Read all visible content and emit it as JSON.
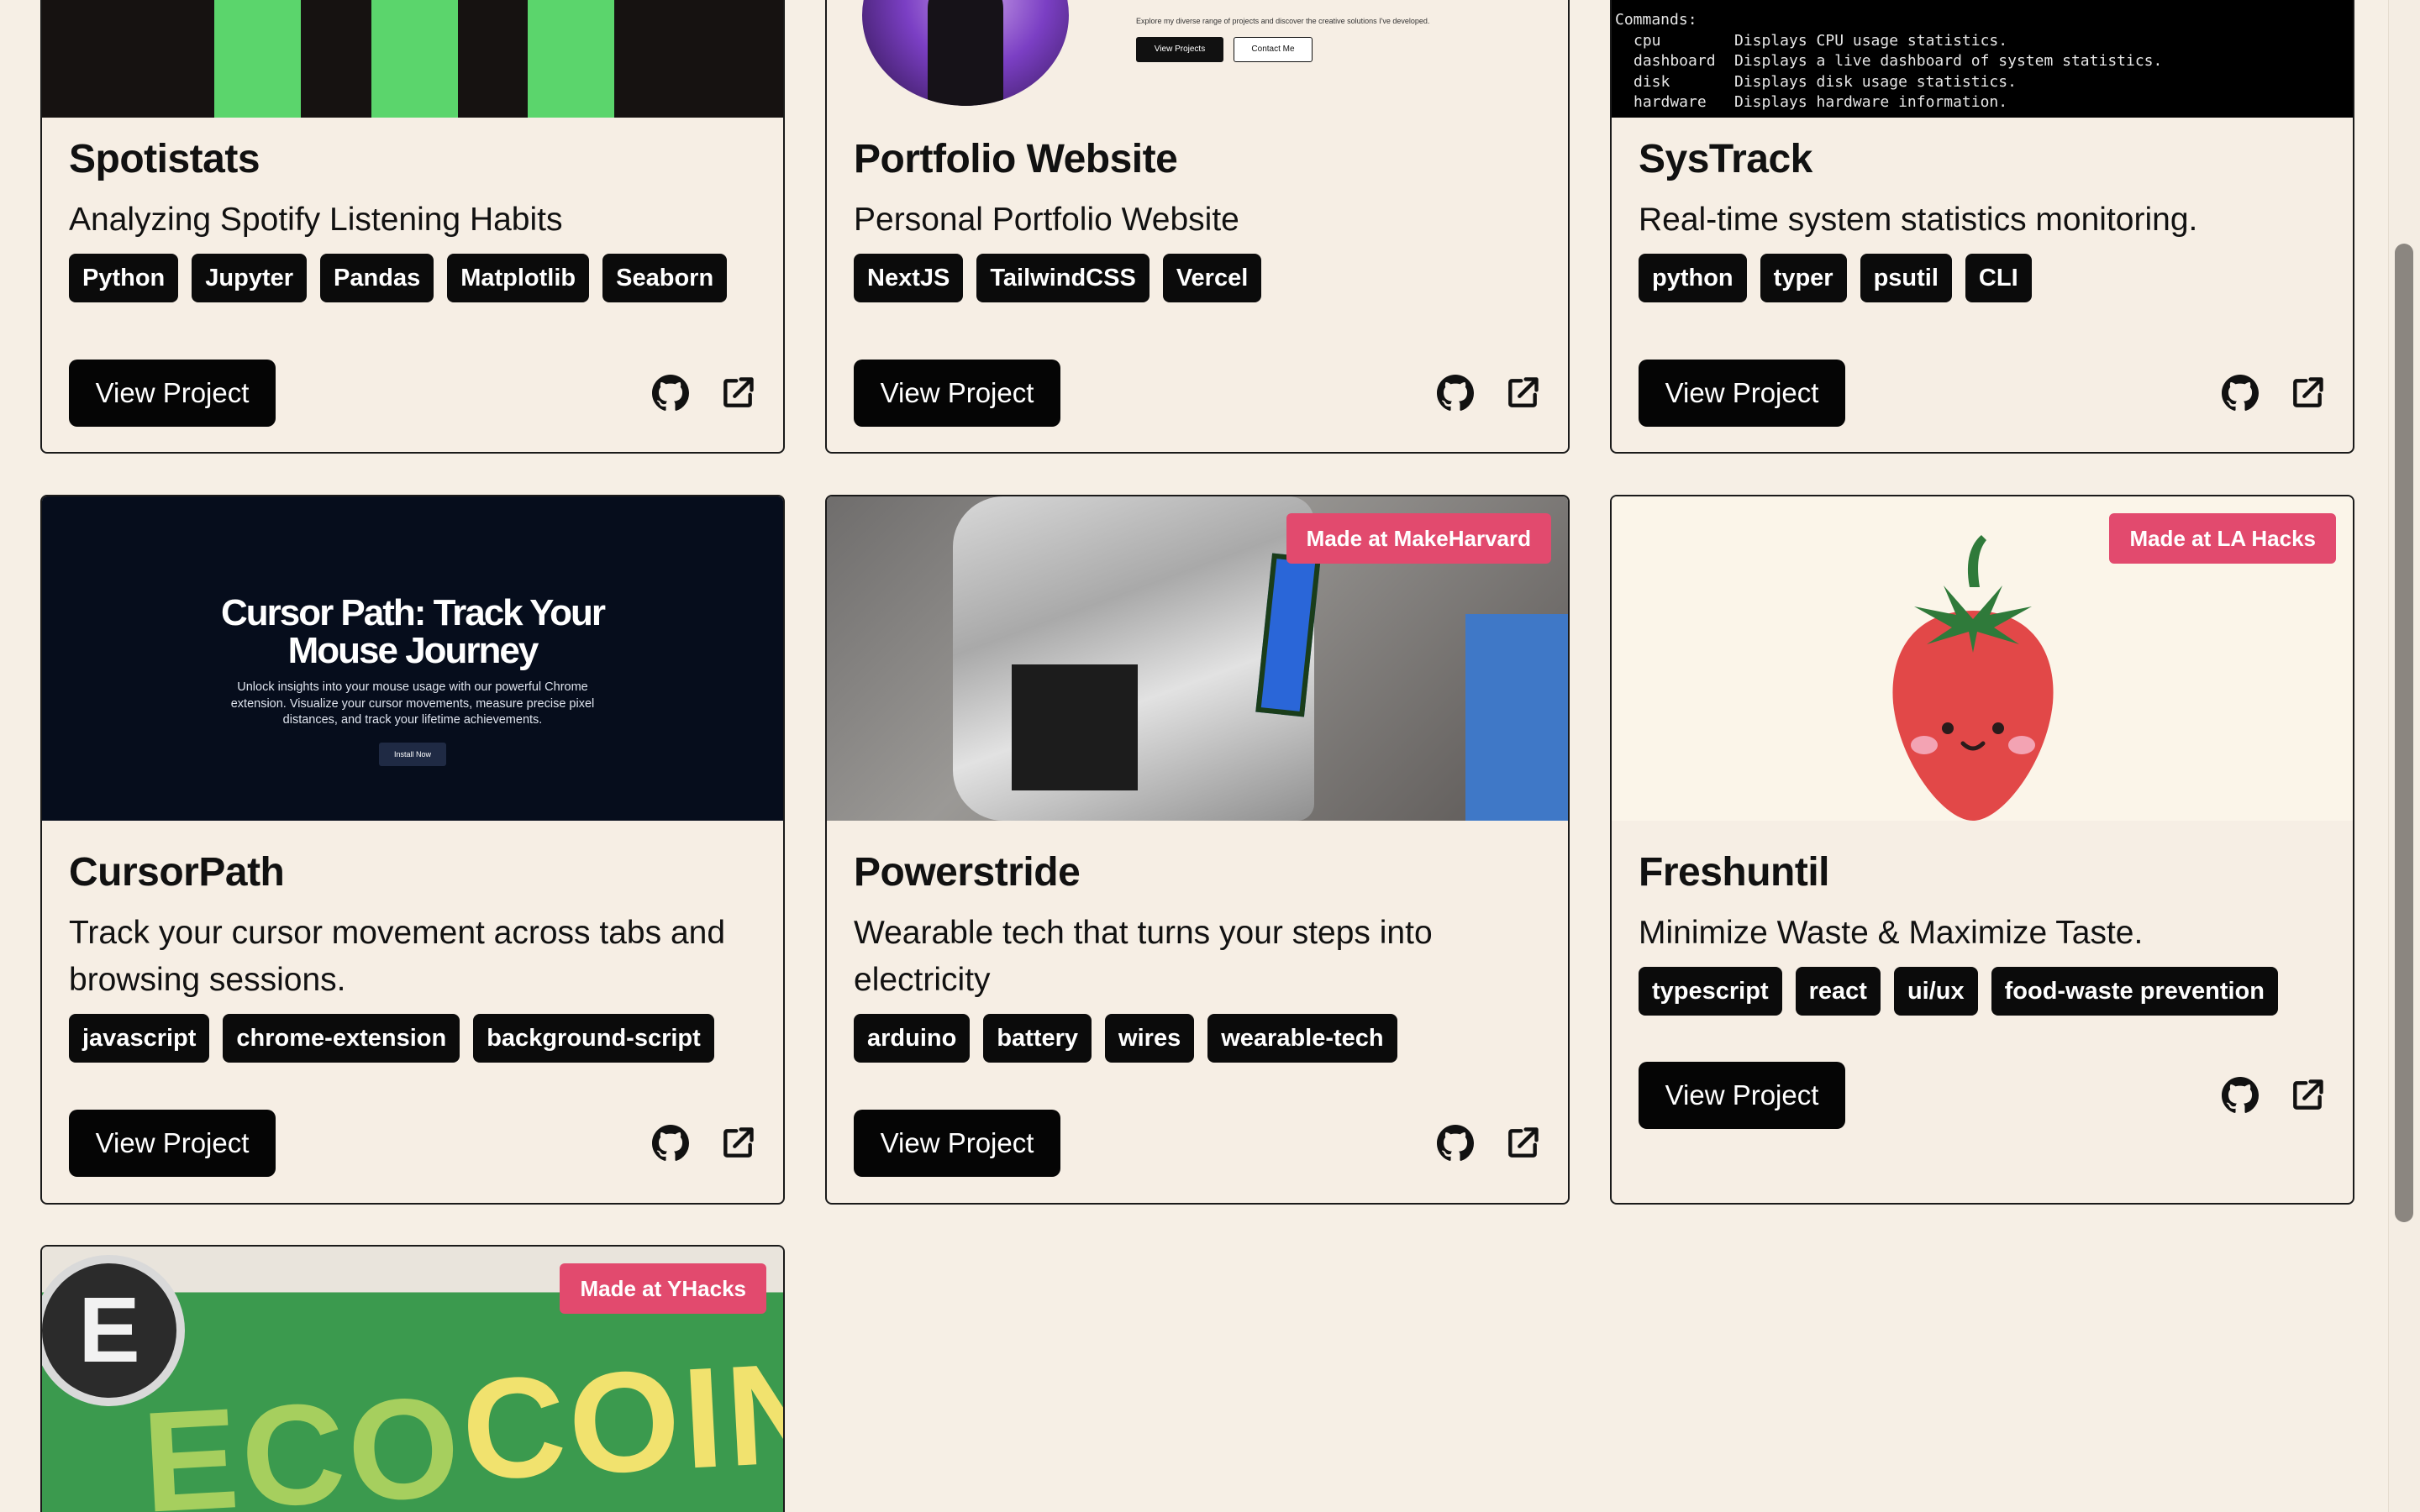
{
  "colors": {
    "background": "#f6efe5",
    "badge": "#e24a6e",
    "tag": "#0b0b0b",
    "button": "#050505"
  },
  "button_label": "View Project",
  "icons": {
    "repo": "github-icon",
    "external": "external-link-icon"
  },
  "cards": [
    {
      "title": "Spotistats",
      "description": "Analyzing Spotify Listening Habits",
      "tags": [
        "Python",
        "Jupyter",
        "Pandas",
        "Matplotlib",
        "Seaborn"
      ]
    },
    {
      "title": "Portfolio Website",
      "description": "Personal Portfolio Website",
      "tags": [
        "NextJS",
        "TailwindCSS",
        "Vercel"
      ],
      "preview": {
        "subtitle": "Explore my diverse range of projects and discover the creative solutions I've developed.",
        "btn1": "View Projects",
        "btn2": "Contact Me"
      }
    },
    {
      "title": "SysTrack",
      "description": "Real-time system statistics monitoring.",
      "tags": [
        "python",
        "typer",
        "psutil",
        "CLI"
      ],
      "terminal": {
        "header": "Commands:",
        "lines": [
          {
            "cmd": "cpu",
            "text": "Displays CPU usage statistics."
          },
          {
            "cmd": "dashboard",
            "text": "Displays a live dashboard of system statistics."
          },
          {
            "cmd": "disk",
            "text": "Displays disk usage statistics."
          },
          {
            "cmd": "hardware",
            "text": "Displays hardware information."
          }
        ]
      }
    },
    {
      "title": "CursorPath",
      "description": "Track your cursor movement across tabs and browsing sessions.",
      "tags": [
        "javascript",
        "chrome-extension",
        "background-script"
      ],
      "preview": {
        "heading_1": "Cursor Path: Track Your",
        "heading_2": "Mouse Journey",
        "line_1": "Unlock insights into your mouse usage with our powerful Chrome",
        "line_2": "extension. Visualize your cursor movements, measure precise pixel",
        "line_3": "distances, and track your lifetime achievements.",
        "cta": "Install Now"
      }
    },
    {
      "title": "Powerstride",
      "description": "Wearable tech that turns your steps into electricity",
      "tags": [
        "arduino",
        "battery",
        "wires",
        "wearable-tech"
      ],
      "badge": "Made at MakeHarvard"
    },
    {
      "title": "Freshuntil",
      "description": "Minimize Waste & Maximize Taste.",
      "tags": [
        "typescript",
        "react",
        "ui/ux",
        "food-waste prevention"
      ],
      "badge": "Made at LA Hacks"
    },
    {
      "badge": "Made at YHacks",
      "preview": {
        "word_1": "ECO",
        "word_2": "COIN",
        "logo_letter": "E"
      }
    }
  ]
}
